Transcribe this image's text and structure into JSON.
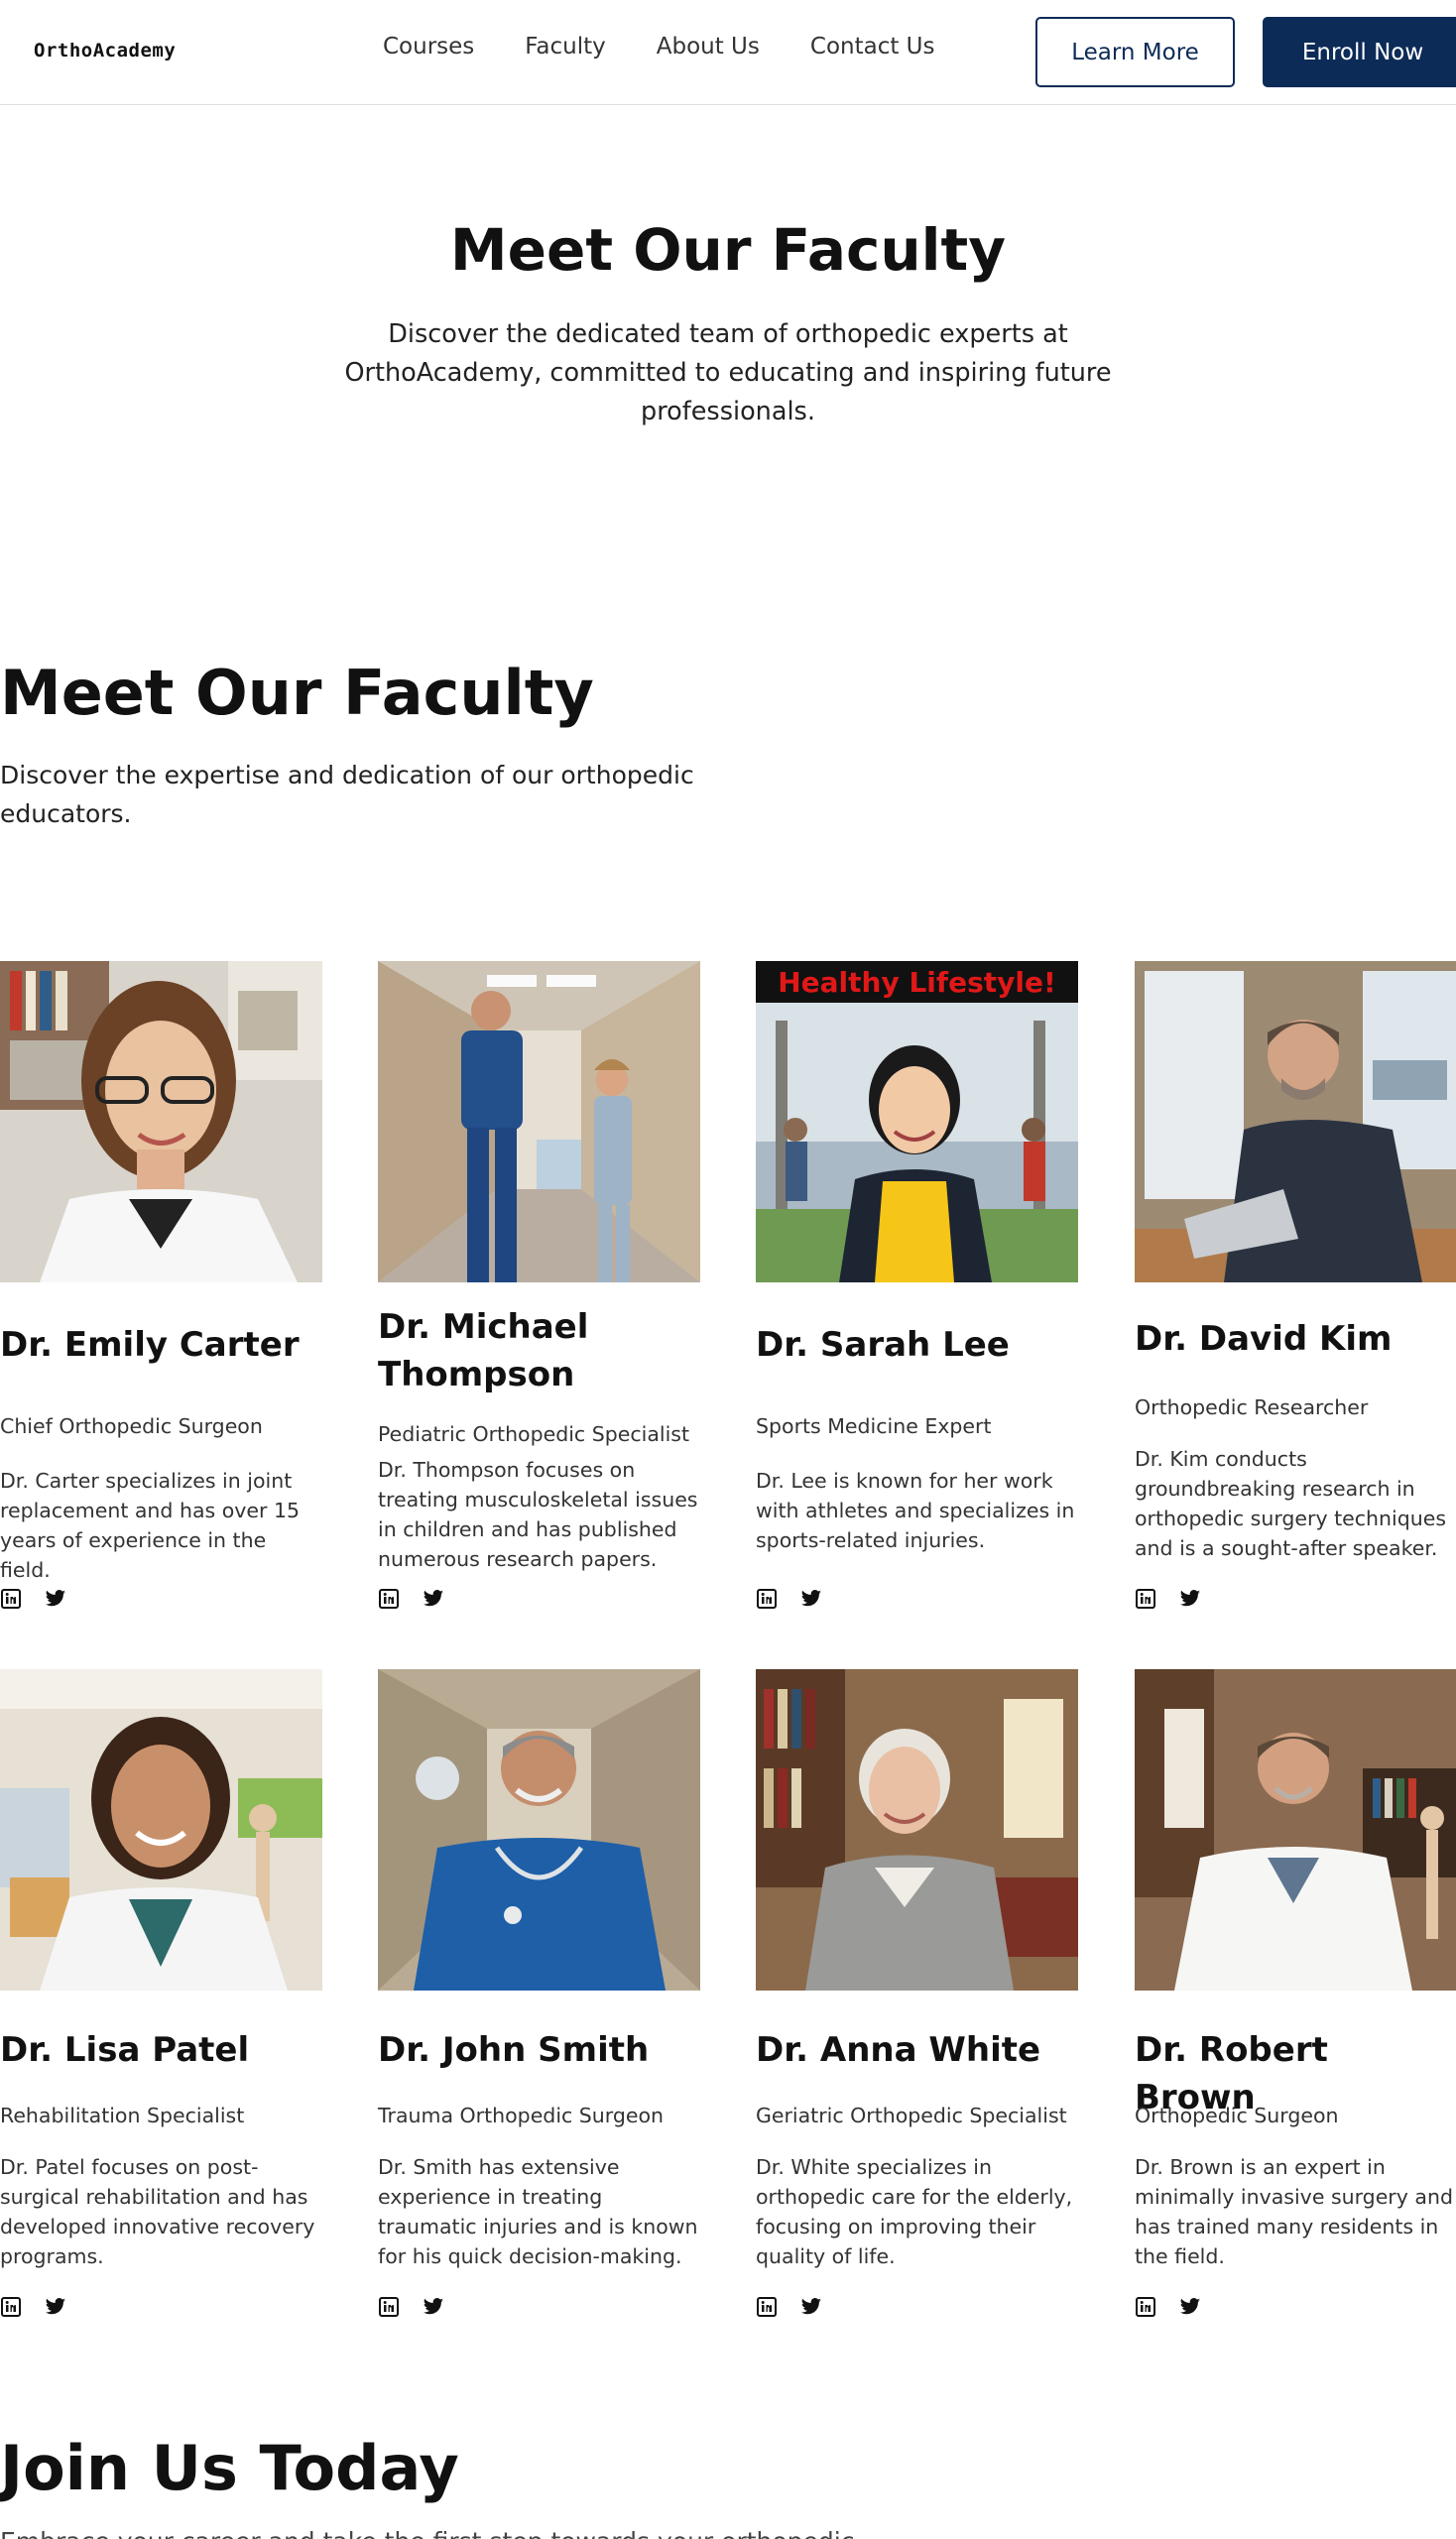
{
  "nav": {
    "logo": "OrthoAcademy",
    "links": [
      "Courses",
      "Faculty",
      "About Us",
      "Contact Us"
    ],
    "learn_more": "Learn More",
    "enroll_now": "Enroll Now"
  },
  "hero": {
    "title": "Meet Our Faculty",
    "subtitle": "Discover the dedicated team of orthopedic experts at OrthoAcademy, committed to educating and inspiring future professionals."
  },
  "faculty_section": {
    "title": "Meet Our Faculty",
    "subtitle": "Discover the expertise and dedication of our orthopedic educators."
  },
  "faculty": [
    {
      "name": "Dr. Emily Carter",
      "role": "Chief Orthopedic Surgeon",
      "bio": "Dr. Carter specializes in joint replacement and has over 15 years of experience in the field."
    },
    {
      "name": "Dr. Michael Thompson",
      "role": "Pediatric Orthopedic Specialist",
      "bio": "Dr. Thompson focuses on treating musculoskeletal issues in children and has published numerous research papers."
    },
    {
      "name": "Dr. Sarah Lee",
      "role": "Sports Medicine Expert",
      "bio": "Dr. Lee is known for her work with athletes and specializes in sports-related injuries.",
      "photo_banner": "Healthy Lifestyle!"
    },
    {
      "name": "Dr. David Kim",
      "role": "Orthopedic Researcher",
      "bio": "Dr. Kim conducts groundbreaking research in orthopedic surgery techniques and is a sought-after speaker."
    },
    {
      "name": "Dr. Lisa Patel",
      "role": "Rehabilitation Specialist",
      "bio": "Dr. Patel focuses on post-surgical rehabilitation and has developed innovative recovery programs."
    },
    {
      "name": "Dr. John Smith",
      "role": "Trauma Orthopedic Surgeon",
      "bio": "Dr. Smith has extensive experience in treating traumatic injuries and is known for his quick decision-making."
    },
    {
      "name": "Dr. Anna White",
      "role": "Geriatric Orthopedic Specialist",
      "bio": "Dr. White specializes in orthopedic care for the elderly, focusing on improving their quality of life."
    },
    {
      "name": "Dr. Robert Brown",
      "role": "Orthopedic Surgeon",
      "bio": "Dr. Brown is an expert in minimally invasive surgery and has trained many residents in the field."
    }
  ],
  "icons": {
    "linkedin": "linkedin-icon",
    "twitter": "twitter-icon"
  },
  "colors": {
    "primary": "#0d2b57",
    "text": "#111111",
    "banner_text": "#e01818"
  },
  "join": {
    "title": "Join Us Today",
    "subtitle": "Embrace your career and take the first step towards your orthopedic"
  }
}
